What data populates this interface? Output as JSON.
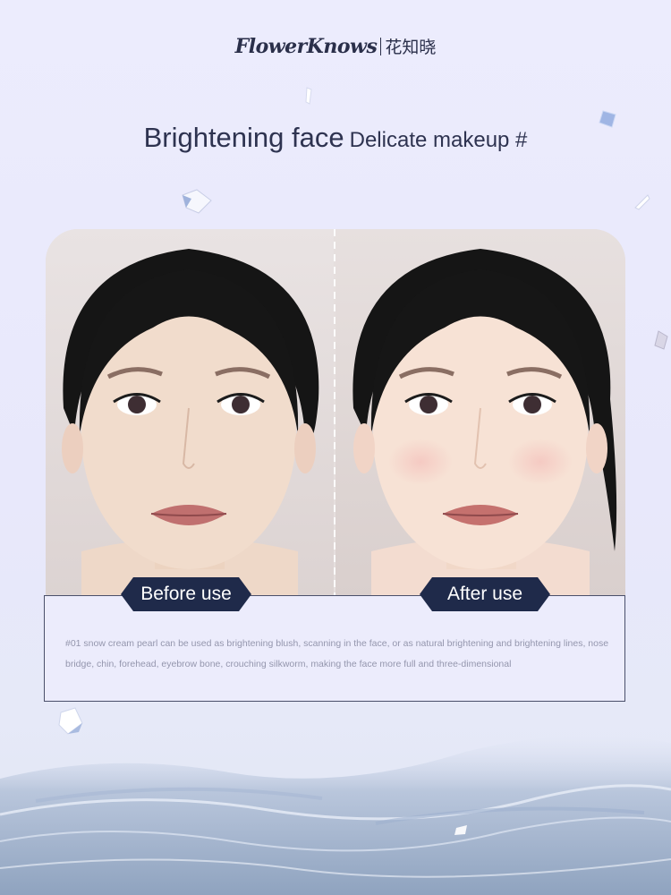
{
  "brand": {
    "name_en": "FlowerKnows",
    "name_cn": "花知晓"
  },
  "headline": {
    "main": "Brightening face",
    "sub": "Delicate makeup #"
  },
  "comparison": {
    "before_label": "Before use",
    "after_label": "After use"
  },
  "description": "#01 snow cream pearl can be used as brightening blush, scanning in the face, or as natural brightening and brightening lines, nose bridge, chin, forehead, eyebrow bone, crouching silkworm, making the face more full and three-dimensional",
  "colors": {
    "background": "#ebebfc",
    "navy": "#1f2a4a",
    "text_dark": "#2e3350",
    "text_muted": "#9496ad"
  }
}
